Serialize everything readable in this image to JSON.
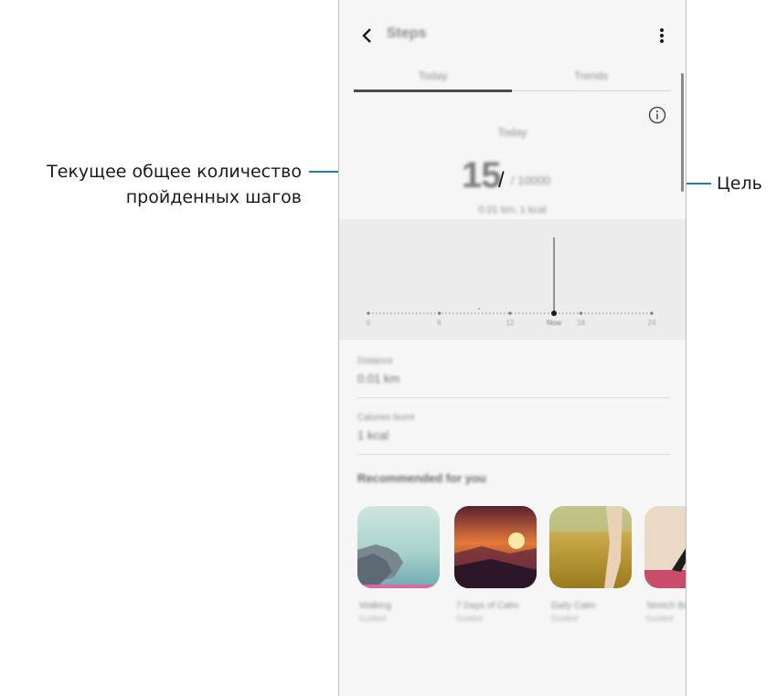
{
  "callouts": {
    "left_line1": "Текущее общее количество",
    "left_line2": "пройденных шагов",
    "right": "Цель"
  },
  "appbar": {
    "title": "Steps",
    "back_icon": "chevron-left-icon",
    "more_icon": "more-vert-icon"
  },
  "tabs": [
    {
      "label": "Today",
      "selected": true
    },
    {
      "label": "Trends",
      "selected": false
    }
  ],
  "info_icon": "info-icon",
  "summary": {
    "label": "Today",
    "steps": "15",
    "goal": "/ 10000",
    "subtitle": "0.01 km, 1 kcal"
  },
  "chart_data": {
    "type": "timeline",
    "ticks": [
      "0",
      "6",
      "12",
      "18",
      "24"
    ],
    "current": "Now"
  },
  "stats": [
    {
      "label": "Distance",
      "value": "0.01 km"
    },
    {
      "label": "Calories burnt",
      "value": "1 kcal"
    }
  ],
  "recommended": {
    "title": "Recommended for you",
    "items": [
      {
        "title": "Walking",
        "sub": "Guided"
      },
      {
        "title": "7 Days of Calm",
        "sub": "Guided"
      },
      {
        "title": "Daily Calm",
        "sub": "Guided"
      },
      {
        "title": "Stretch Break",
        "sub": "Guided"
      }
    ]
  },
  "colors": {
    "accent": "#1f7fa4"
  }
}
